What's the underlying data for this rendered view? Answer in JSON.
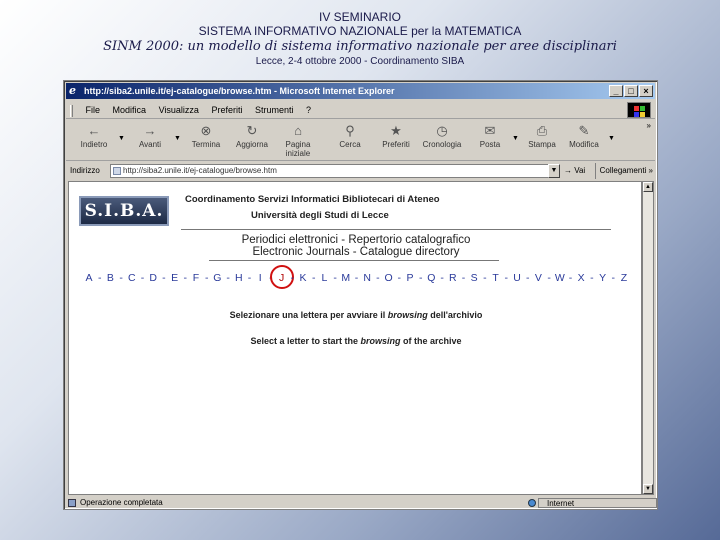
{
  "slide": {
    "line1": "IV SEMINARIO",
    "line2": "SISTEMA INFORMATIVO NAZIONALE per la MATEMATICA",
    "line3": "SINM 2000: un modello di sistema informativo nazionale per aree disciplinari",
    "line4": "Lecce, 2-4 ottobre 2000 - Coordinamento SIBA"
  },
  "browser": {
    "title": "http://siba2.unile.it/ej-catalogue/browse.htm - Microsoft Internet Explorer",
    "menu": [
      "File",
      "Modifica",
      "Visualizza",
      "Preferiti",
      "Strumenti",
      "?"
    ],
    "toolbar": [
      {
        "label": "Indietro",
        "icon": "back-arrow-icon",
        "glyph": "←"
      },
      {
        "label": "Avanti",
        "icon": "forward-arrow-icon",
        "glyph": "→"
      },
      {
        "label": "Termina",
        "icon": "stop-icon",
        "glyph": "⊗"
      },
      {
        "label": "Aggiorna",
        "icon": "refresh-icon",
        "glyph": "↻"
      },
      {
        "label": "Pagina iniziale",
        "icon": "home-icon",
        "glyph": "⌂"
      },
      {
        "label": "Cerca",
        "icon": "search-icon",
        "glyph": "⚲"
      },
      {
        "label": "Preferiti",
        "icon": "favorites-icon",
        "glyph": "★"
      },
      {
        "label": "Cronologia",
        "icon": "history-icon",
        "glyph": "◷"
      },
      {
        "label": "Posta",
        "icon": "mail-icon",
        "glyph": "✉"
      },
      {
        "label": "Stampa",
        "icon": "print-icon",
        "glyph": "⎙"
      },
      {
        "label": "Modifica",
        "icon": "edit-icon",
        "glyph": "✎"
      }
    ],
    "address_label": "Indirizzo",
    "address_value": "http://siba2.unile.it/ej-catalogue/browse.htm",
    "go_label": "Vai",
    "links_label": "Collegamenti »",
    "status_text": "Operazione completata",
    "status_zone": "Internet"
  },
  "page": {
    "logo_text": "S.I.B.A.",
    "coordinamento": "Coordinamento Servizi Informatici Bibliotecari di Ateneo",
    "universita": "Università degli Studi di Lecce",
    "title_it": "Periodici elettronici - Repertorio catalografico",
    "title_en": "Electronic Journals - Catalogue directory",
    "letters": [
      "A",
      "B",
      "C",
      "D",
      "E",
      "F",
      "G",
      "H",
      "I",
      "J",
      "K",
      "L",
      "M",
      "N",
      "O",
      "P",
      "Q",
      "R",
      "S",
      "T",
      "U",
      "V",
      "W",
      "X",
      "Y",
      "Z"
    ],
    "selected_letter": "J",
    "msg_it_pre": "Selezionare una lettera per avviare il ",
    "msg_it_em": "browsing",
    "msg_it_post": " dell'archivio",
    "msg_en_pre": "Select a letter to start the ",
    "msg_en_em": "browsing",
    "msg_en_post": " of the archive"
  },
  "colors": {
    "link": "#2a3a9a",
    "highlight_circle": "#d01010",
    "titlebar": "#0a246a"
  }
}
